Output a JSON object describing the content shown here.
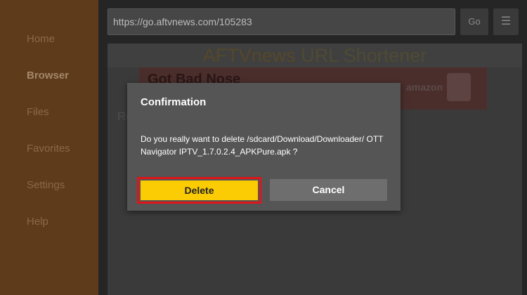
{
  "sidebar": {
    "items": [
      {
        "label": "Home"
      },
      {
        "label": "Browser"
      },
      {
        "label": "Files"
      },
      {
        "label": "Favorites"
      },
      {
        "label": "Settings"
      },
      {
        "label": "Help"
      }
    ],
    "active": "Browser"
  },
  "toolbar": {
    "url_value": "https://go.aftvnews.com/105283",
    "go_label": "Go",
    "menu_icon": "☰"
  },
  "webpage": {
    "brand": "AFTVnews",
    "title_rest": " URL Shortener",
    "ad_text": "Got Bad Nose",
    "ad_brand": "amazon",
    "heading_fragment": "Ro"
  },
  "dialog": {
    "title": "Confirmation",
    "message": "Do you really want to delete /sdcard/Download/Downloader/ OTT Navigator IPTV_1.7.0.2.4_APKPure.apk ?",
    "delete_label": "Delete",
    "cancel_label": "Cancel"
  },
  "colors": {
    "sidebar": "#5e3b1a",
    "highlight": "#e0141a",
    "primary_button": "#fbcc04"
  }
}
